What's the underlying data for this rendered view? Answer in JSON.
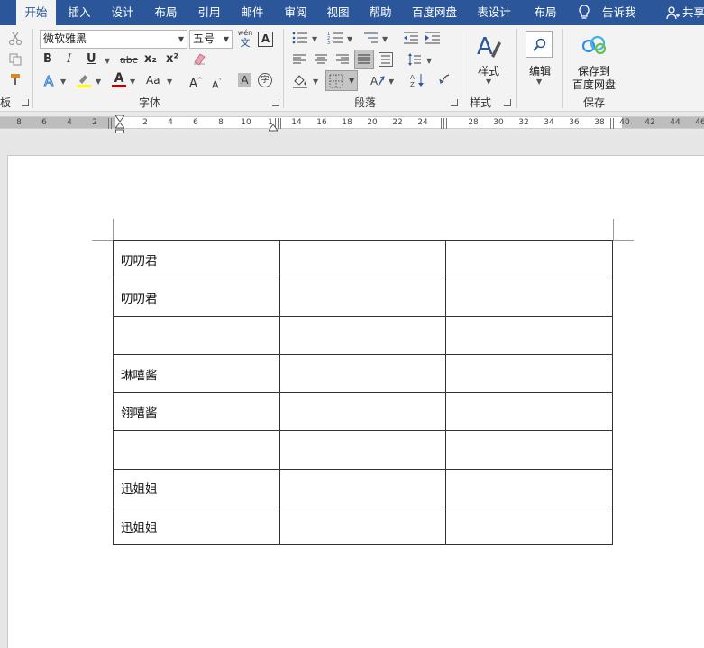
{
  "tabs": [
    {
      "label": "开始",
      "active": true
    },
    {
      "label": "插入"
    },
    {
      "label": "设计"
    },
    {
      "label": "布局"
    },
    {
      "label": "引用"
    },
    {
      "label": "邮件"
    },
    {
      "label": "审阅"
    },
    {
      "label": "视图"
    },
    {
      "label": "帮助"
    },
    {
      "label": "百度网盘"
    },
    {
      "label": "表设计"
    },
    {
      "label": "布局"
    }
  ],
  "tell_me": "告诉我",
  "share": "共享",
  "font": {
    "name": "微软雅黑",
    "size": "五号",
    "pinyin_top": "wén",
    "pinyin_bottom": "文",
    "bold": "B",
    "italic": "I",
    "underline": "U",
    "strike": "abc",
    "subscript": "x₂",
    "superscript": "x²",
    "font_color_letter": "A",
    "case": "Aa",
    "grow": "A",
    "shrink": "A",
    "shade_letter": "A",
    "enclose": "字",
    "group_label": "字体"
  },
  "paragraph": {
    "group_label": "段落"
  },
  "styles": {
    "button_label": "样式",
    "group_label": "样式"
  },
  "editing": {
    "button_label": "编辑"
  },
  "save": {
    "line1": "保存到",
    "line2": "百度网盘",
    "group_label": "保存"
  },
  "clipboard": {
    "group_label": "板"
  },
  "ruler": {
    "numbers": [
      "8",
      "6",
      "4",
      "2",
      "2",
      "4",
      "6",
      "8",
      "10",
      "1",
      "14",
      "16",
      "18",
      "20",
      "22",
      "24",
      "28",
      "30",
      "32",
      "34",
      "36",
      "38",
      "40",
      "42",
      "44",
      "46"
    ]
  },
  "table": {
    "rows": [
      [
        "叨叨君",
        "",
        ""
      ],
      [
        "叨叨君",
        "",
        ""
      ],
      [
        "",
        "",
        ""
      ],
      [
        "琳嘻酱",
        "",
        ""
      ],
      [
        "翎嘻酱",
        "",
        ""
      ],
      [
        "",
        "",
        ""
      ],
      [
        "迅姐姐",
        "",
        ""
      ],
      [
        "迅姐姐",
        "",
        ""
      ]
    ]
  },
  "colors": {
    "tab_bar": "#2b579a",
    "ribbon": "#f3f3f3",
    "font_color_bar": "#c00000",
    "highlight_bar": "#ffff00"
  }
}
